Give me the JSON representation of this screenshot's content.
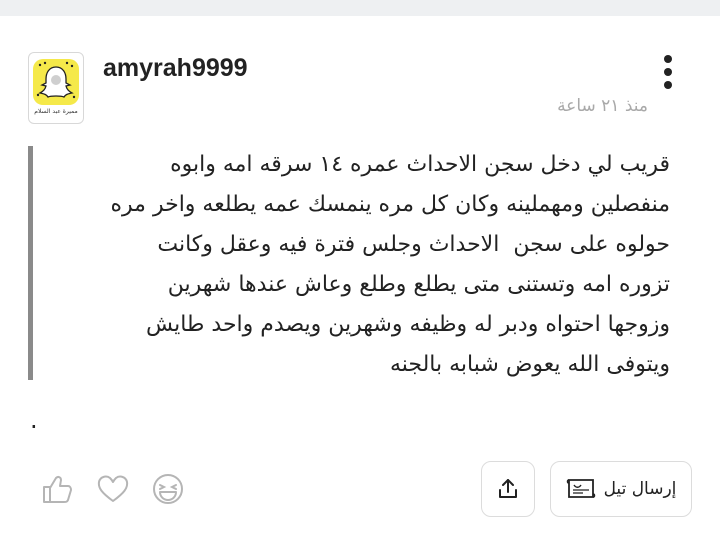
{
  "post": {
    "username": "amyrah9999",
    "timestamp": "منذ ٢١ ساعة",
    "body_lines": [
      "قريب لي دخل سجن الاحداث عمره ١٤ سرقه امه وابوه",
      "منفصلين ومهملينه وكان كل مره ينمسك عمه يطلعه واخر مره",
      "حولوه على سجن  الاحداث وجلس فترة فيه وعقل وكانت",
      "تزوره امه وتستنى متى يطلع وطلع وعاش عندها شهرين",
      "وزوجها احتواه ودبر له وظيفه وشهرين ويصدم واحد طايش",
      "ويتوفى الله يعوض شبابه بالجنه"
    ],
    "trailing": "."
  },
  "avatar": {
    "icon": "snapchat-ghost-avatar",
    "caption": "مميرة عبد السلام",
    "bg_color": "#f5e94a"
  },
  "actions": {
    "like_icon": "thumbs-up-icon",
    "heart_icon": "heart-icon",
    "laugh_icon": "laugh-emoji-icon",
    "share_icon": "share-upload-icon",
    "tell_label": "إرسال تيل",
    "tell_icon": "scroll-card-icon"
  },
  "colors": {
    "accent_gray": "#8a8a8a",
    "muted": "#a9a9a9",
    "text": "#222222"
  }
}
